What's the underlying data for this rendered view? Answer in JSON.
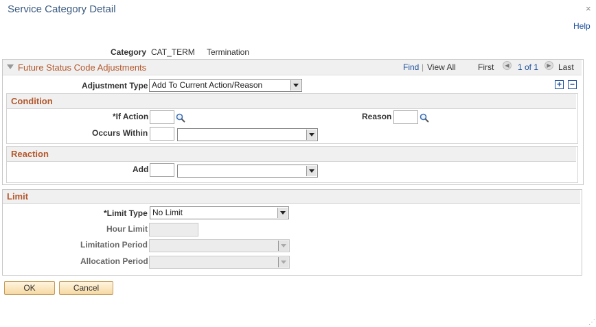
{
  "window": {
    "title": "Service Category Detail",
    "close_glyph": "×",
    "help": "Help"
  },
  "category": {
    "label": "Category",
    "code": "CAT_TERM",
    "description": "Termination"
  },
  "scroll_area": {
    "title": "Future Status Code Adjustments",
    "find": "Find",
    "separator": "|",
    "view_all": "View All",
    "first": "First",
    "range": "1 of 1",
    "last": "Last",
    "add_glyph": "+",
    "remove_glyph": "−"
  },
  "adjustment_type": {
    "label": "Adjustment Type",
    "value": "Add To Current Action/Reason"
  },
  "condition": {
    "header": "Condition",
    "if_action_label": "*If Action",
    "if_action_value": "",
    "reason_label": "Reason",
    "reason_value": "",
    "occurs_within_label": "Occurs Within",
    "occurs_within_value": "",
    "occurs_within_unit": ""
  },
  "reaction": {
    "header": "Reaction",
    "add_label": "Add",
    "add_value": "",
    "add_unit": ""
  },
  "limit": {
    "header": "Limit",
    "limit_type_label": "*Limit Type",
    "limit_type_value": "No Limit",
    "hour_limit_label": "Hour Limit",
    "hour_limit_value": "",
    "limitation_period_label": "Limitation Period",
    "limitation_period_value": "",
    "allocation_period_label": "Allocation Period",
    "allocation_period_value": ""
  },
  "buttons": {
    "ok": "OK",
    "cancel": "Cancel"
  },
  "colors": {
    "section_title": "#b4582c",
    "link": "#1b4f9c",
    "title": "#3a5a80"
  }
}
